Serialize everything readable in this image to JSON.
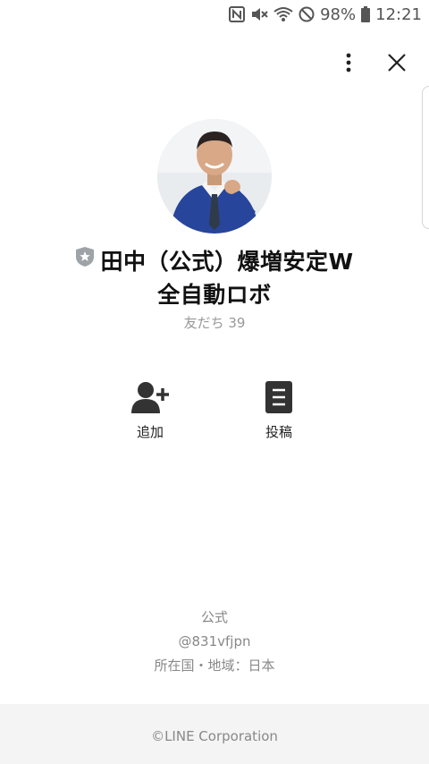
{
  "status_bar": {
    "battery": "98%",
    "time": "12:21"
  },
  "profile": {
    "name_line1": "田中（公式）爆増安定W",
    "name_line2": "全自動ロボ",
    "friends_label": "友だち 39"
  },
  "actions": {
    "add_label": "追加",
    "post_label": "投稿"
  },
  "info": {
    "type": "公式",
    "account_id": "@831vfjpn",
    "region": "所在国・地域：日本"
  },
  "footer": {
    "copyright": "©LINE Corporation"
  },
  "colors": {
    "accent_dark": "#333333",
    "muted_text": "#888888",
    "footer_bg": "#f4f4f4"
  }
}
